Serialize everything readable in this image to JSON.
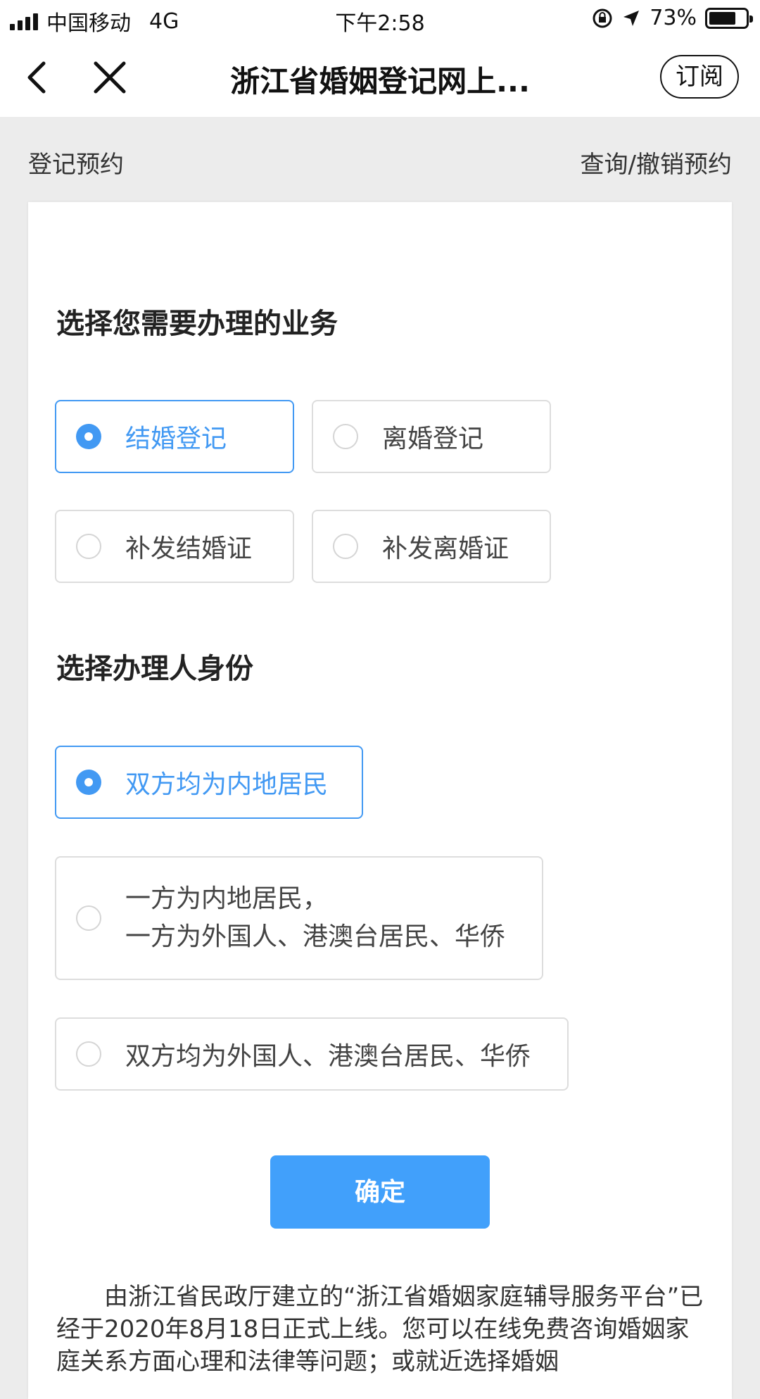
{
  "status_bar": {
    "carrier": "中国移动",
    "network": "4G",
    "time": "下午2:58",
    "battery": "73%",
    "battery_level": 0.73
  },
  "nav": {
    "title": "浙江省婚姻登记网上...",
    "subscribe_label": "订阅"
  },
  "tabs": {
    "register": "登记预约",
    "query": "查询/撤销预约"
  },
  "business": {
    "title": "选择您需要办理的业务",
    "options": [
      {
        "label": "结婚登记",
        "selected": true
      },
      {
        "label": "离婚登记",
        "selected": false
      },
      {
        "label": "补发结婚证",
        "selected": false
      },
      {
        "label": "补发离婚证",
        "selected": false
      }
    ]
  },
  "identity": {
    "title": "选择办理人身份",
    "options": [
      {
        "label": "双方均为内地居民",
        "selected": true
      },
      {
        "line1": "一方为内地居民，",
        "line2": "一方为外国人、港澳台居民、华侨",
        "selected": false
      },
      {
        "label": "双方均为外国人、港澳台居民、华侨",
        "selected": false
      }
    ]
  },
  "confirm_label": "确定",
  "notice": "由浙江省民政厅建立的“浙江省婚姻家庭辅导服务平台”已经于2020年8月18日正式上线。您可以在线免费咨询婚姻家庭关系方面心理和法律等问题；或就近选择婚姻"
}
